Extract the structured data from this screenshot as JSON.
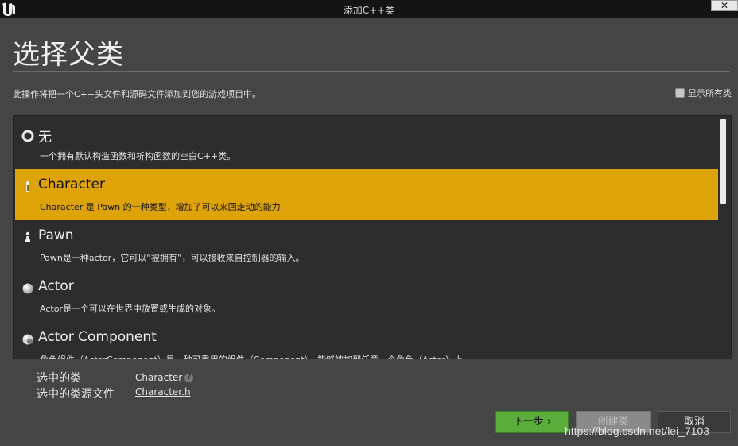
{
  "window": {
    "title": "添加C++类",
    "close_label": "✕"
  },
  "page": {
    "heading": "选择父类",
    "description": "此操作将把一个C++头文件和源码文件添加到您的游戏项目中。",
    "show_all_label": "显示所有类",
    "show_all_checked": false
  },
  "classes": [
    {
      "name": "无",
      "description": "一个拥有默认构造函数和析构函数的空白C++类。",
      "icon": "empty-circle-icon"
    },
    {
      "name": "Character",
      "description": "Character 是 Pawn 的一种类型，增加了可以来回走动的能力",
      "icon": "character-icon",
      "selected": true
    },
    {
      "name": "Pawn",
      "description": "Pawn是一种actor，它可以“被拥有”，可以接收来自控制器的输入。",
      "icon": "pawn-icon"
    },
    {
      "name": "Actor",
      "description": "Actor是一个可以在世界中放置或生成的对象。",
      "icon": "sphere-icon"
    },
    {
      "name": "Actor Component",
      "description": "角色组件（ActorComponent）是一种可重用的组件（Component），能够被加到任意一个角色（Actor）上",
      "icon": "component-icon"
    }
  ],
  "selection": {
    "class_label": "选中的类",
    "class_value": "Character",
    "source_label": "选中的类源文件",
    "source_value": "Character.h"
  },
  "buttons": {
    "next": "下一步 ›",
    "create": "创建类",
    "cancel": "取消"
  },
  "watermark": "https://blog.csdn.net/lei_7103",
  "colors": {
    "selected_row": "#dea309",
    "next_button": "#5aad3a"
  }
}
